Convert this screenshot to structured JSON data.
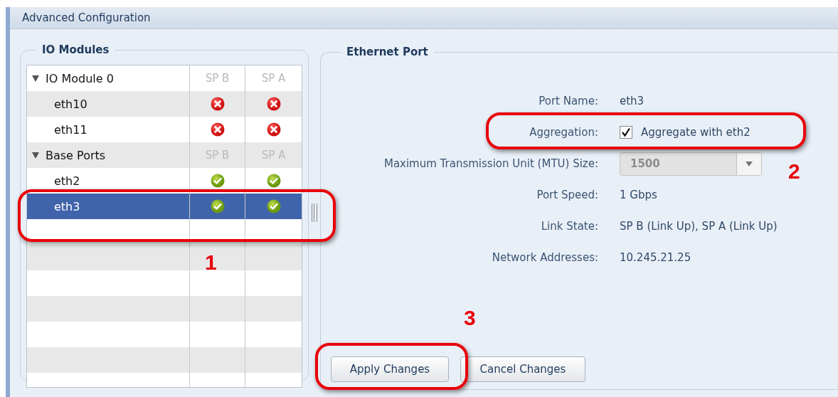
{
  "window": {
    "title": "Advanced Configuration"
  },
  "io_modules": {
    "title": "IO Modules",
    "groups": [
      {
        "label": "IO Module 0",
        "expanded": true,
        "columns": [
          "SP B",
          "SP A"
        ],
        "children": [
          {
            "label": "eth10",
            "sp_b_link_up": false,
            "sp_a_link_up": false,
            "selected": false
          },
          {
            "label": "eth11",
            "sp_b_link_up": false,
            "sp_a_link_up": false,
            "selected": false
          }
        ]
      },
      {
        "label": "Base Ports",
        "expanded": true,
        "columns": [
          "SP B",
          "SP A"
        ],
        "children": [
          {
            "label": "eth2",
            "sp_b_link_up": true,
            "sp_a_link_up": true,
            "selected": false
          },
          {
            "label": "eth3",
            "sp_b_link_up": true,
            "sp_a_link_up": true,
            "selected": true
          }
        ]
      }
    ]
  },
  "ethernet_port": {
    "title": "Ethernet Port",
    "fields": [
      {
        "kind": "text",
        "label": "Port Name:",
        "value": "eth3"
      },
      {
        "kind": "checkbox",
        "label": "Aggregation:",
        "checked": true,
        "text": "Aggregate with eth2"
      },
      {
        "kind": "dropdown",
        "label": "Maximum Transmission Unit (MTU) Size:",
        "value": "1500",
        "disabled": true
      },
      {
        "kind": "text",
        "label": "Port Speed:",
        "value": "1 Gbps"
      },
      {
        "kind": "text",
        "label": "Link State:",
        "value": "SP B (Link Up), SP A (Link Up)"
      },
      {
        "kind": "text",
        "label": "Network Addresses:",
        "value": "10.245.21.25"
      }
    ],
    "buttons": [
      "Apply Changes",
      "Cancel Changes"
    ]
  },
  "annotations": [
    {
      "label": "1"
    },
    {
      "label": "2"
    },
    {
      "label": "3"
    }
  ]
}
